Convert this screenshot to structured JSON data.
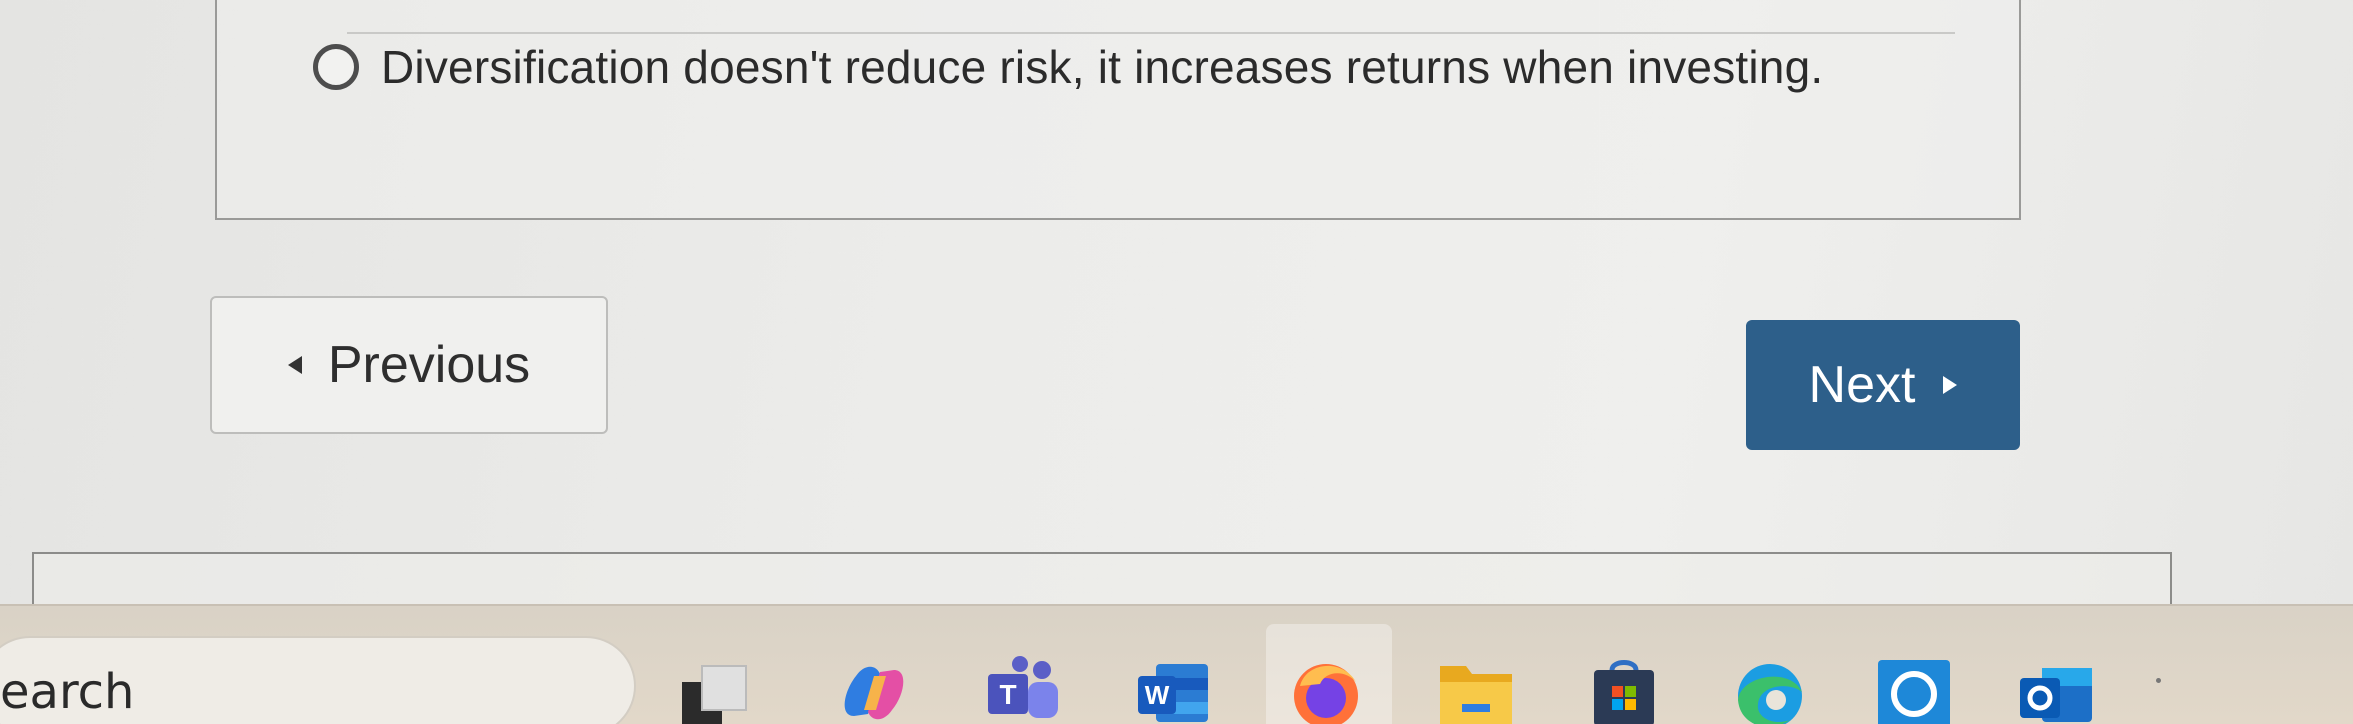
{
  "question": {
    "option_text": "Diversification doesn't reduce risk, it increases returns when investing."
  },
  "navigation": {
    "previous_label": "Previous",
    "next_label": "Next"
  },
  "taskbar": {
    "search_text": "earch",
    "apps": [
      "task-view-icon",
      "copilot-icon",
      "teams-icon",
      "word-icon",
      "firefox-icon",
      "file-explorer-icon",
      "store-icon",
      "edge-icon",
      "cortana-icon",
      "outlook-icon"
    ]
  },
  "colors": {
    "next_button": "#2d5f8a",
    "page_background": "#ececea"
  }
}
